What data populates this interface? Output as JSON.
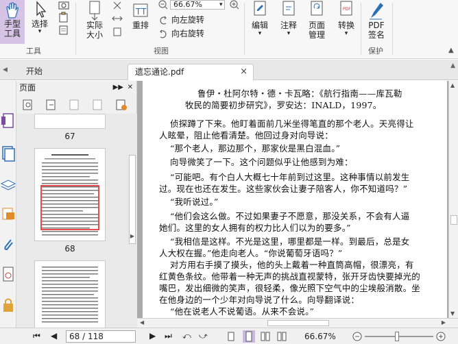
{
  "ribbon": {
    "hand_tool": "手型\n工具",
    "hand_tool_l1": "手型",
    "hand_tool_l2": "工具",
    "select": "选择",
    "actual_size_l1": "实际",
    "actual_size_l2": "大小",
    "reflow": "重排",
    "zoom_value": "66.67%",
    "rotate_left": "向左旋转",
    "rotate_right": "向右旋转",
    "edit": "编辑",
    "annotate": "注释",
    "page_manage_l1": "页面",
    "page_manage_l2": "管理",
    "convert": "转换",
    "pdf_sign_l1": "PDF",
    "pdf_sign_l2": "签名",
    "group_tools": "工具",
    "group_view": "视图",
    "group_protect": "保护"
  },
  "tabs": {
    "start": "开始",
    "document": "遗忘通论.pdf",
    "close": "×"
  },
  "thumbnails": {
    "header": "页面",
    "pages": [
      {
        "number": "67"
      },
      {
        "number": "68",
        "selected": true
      },
      {
        "number": ""
      }
    ]
  },
  "document": {
    "lines": [
      "鲁伊・杜阿尔特・德・卡瓦略：《航行指南——库瓦勒",
      "牧民的简要初步研究》，罗安达：INALD，1997。",
      "侦探蹲了下来。他盯着面前几米坐得笔直的那个老人。天亮得让",
      "人眩晕，阻止他看清楚。他回过身对向导说：",
      "“那个老人，那边那个，那家伙是黑白混血。”",
      "向导微笑了一下。这个问题似乎让他感到为难：",
      "“可能吧。有个白人大概七十年前到过这里。这种事情以前发生",
      "过。现在也还在发生。这些家伙会让妻子陪客人，你不知道吗？”",
      "“我听说过。”",
      "“他们会这么做。不过如果妻子不愿意，那没关系，不会有人逼",
      "她们。这里的女人拥有的权力比人们以为的要多。”",
      "“我相信是这样。不光是这里，哪里都是一样。到最后，总是女",
      "人大权在握。”他走向老人。“你说葡萄牙语吗？”",
      "对方用右手摸了摸头，他的头上戴着一种直筒高帽，很漂亮，有",
      "红黄色条纹。他带着一种无声的挑战直视蒙特，张开牙齿快要掉光的",
      "嘴巴，发出细微的笑声，很轻柔，像光照下空气中的尘埃般消散。坐",
      "在他身边的一个少年对向导说了什么。向导翻译说：",
      "“他在说老人不说葡语。从来不会说。”"
    ]
  },
  "status": {
    "page_display": "68 / 118",
    "zoom": "66.67%"
  },
  "colors": {
    "ribbon_bg": "#f7f7f7",
    "accent_blue": "#2a6fb8",
    "hand_tool_active": "#d6c3e6",
    "selected_thumb_border": "#e02020"
  }
}
